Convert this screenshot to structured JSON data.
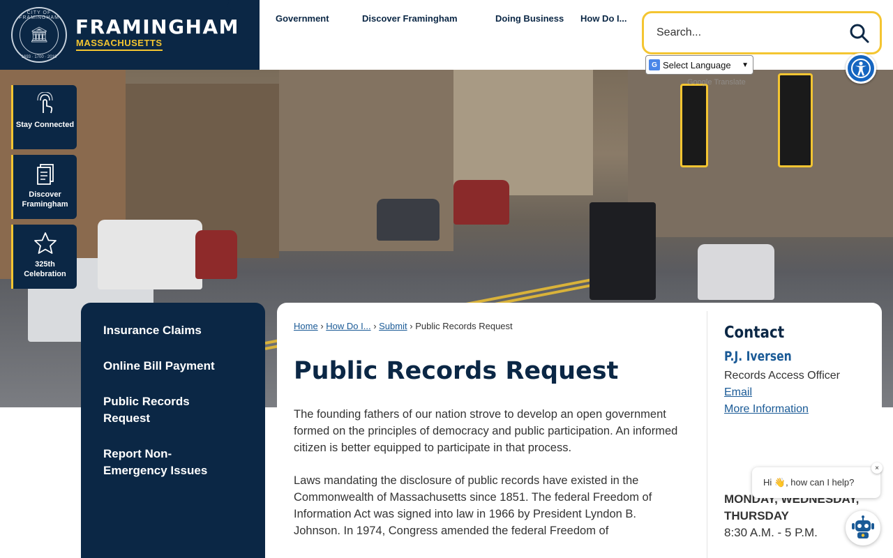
{
  "header": {
    "seal_top": "CITY OF FRAMINGHAM",
    "seal_bottom": "1693 · 1700 · 2018",
    "city": "FRAMINGHAM",
    "state": "MASSACHUSETTS"
  },
  "nav": [
    {
      "label": "Government"
    },
    {
      "label": "Discover Framingham"
    },
    {
      "label": "Doing Business"
    },
    {
      "label": "How Do I..."
    }
  ],
  "search": {
    "placeholder": "Search..."
  },
  "language": {
    "label": "Select Language",
    "powered": "Google Translate"
  },
  "quick_links": [
    {
      "label": "Stay Connected",
      "icon": "touch-icon"
    },
    {
      "label": "Discover Framingham",
      "icon": "document-icon"
    },
    {
      "label": "325th Celebration",
      "icon": "star-icon"
    }
  ],
  "sidenav": [
    {
      "label": "Insurance Claims"
    },
    {
      "label": "Online Bill Payment"
    },
    {
      "label": "Public Records Request"
    },
    {
      "label": "Report Non-Emergency Issues"
    }
  ],
  "breadcrumb": {
    "home": "Home",
    "howdoi": "How Do I...",
    "submit": "Submit",
    "current": "Public Records Request"
  },
  "page": {
    "title": "Public Records Request",
    "para1": "The founding fathers of our nation strove to develop an open government formed on the principles of democracy and public participation. An informed citizen is better equipped to participate in that process.",
    "para2": "Laws mandating the disclosure of public records have existed in the Commonwealth of Massachusetts since 1851. The federal Freedom of Information Act was signed into law in 1966 by President Lyndon B. Johnson. In 1974, Congress amended the federal Freedom of"
  },
  "contact": {
    "heading": "Contact",
    "name": "P.J. Iversen",
    "role": "Records Access Officer",
    "email": "Email",
    "more": "More Information",
    "days": "MONDAY, WEDNESDAY, THURSDAY",
    "time": "8:30 A.M. - 5 P.M."
  },
  "chat": {
    "greeting": "Hi 👋, how can I help?",
    "close": "×"
  },
  "colors": {
    "navy": "#0b2745",
    "gold": "#f4c531",
    "link": "#1a5a96",
    "a11y": "#1565c0"
  }
}
